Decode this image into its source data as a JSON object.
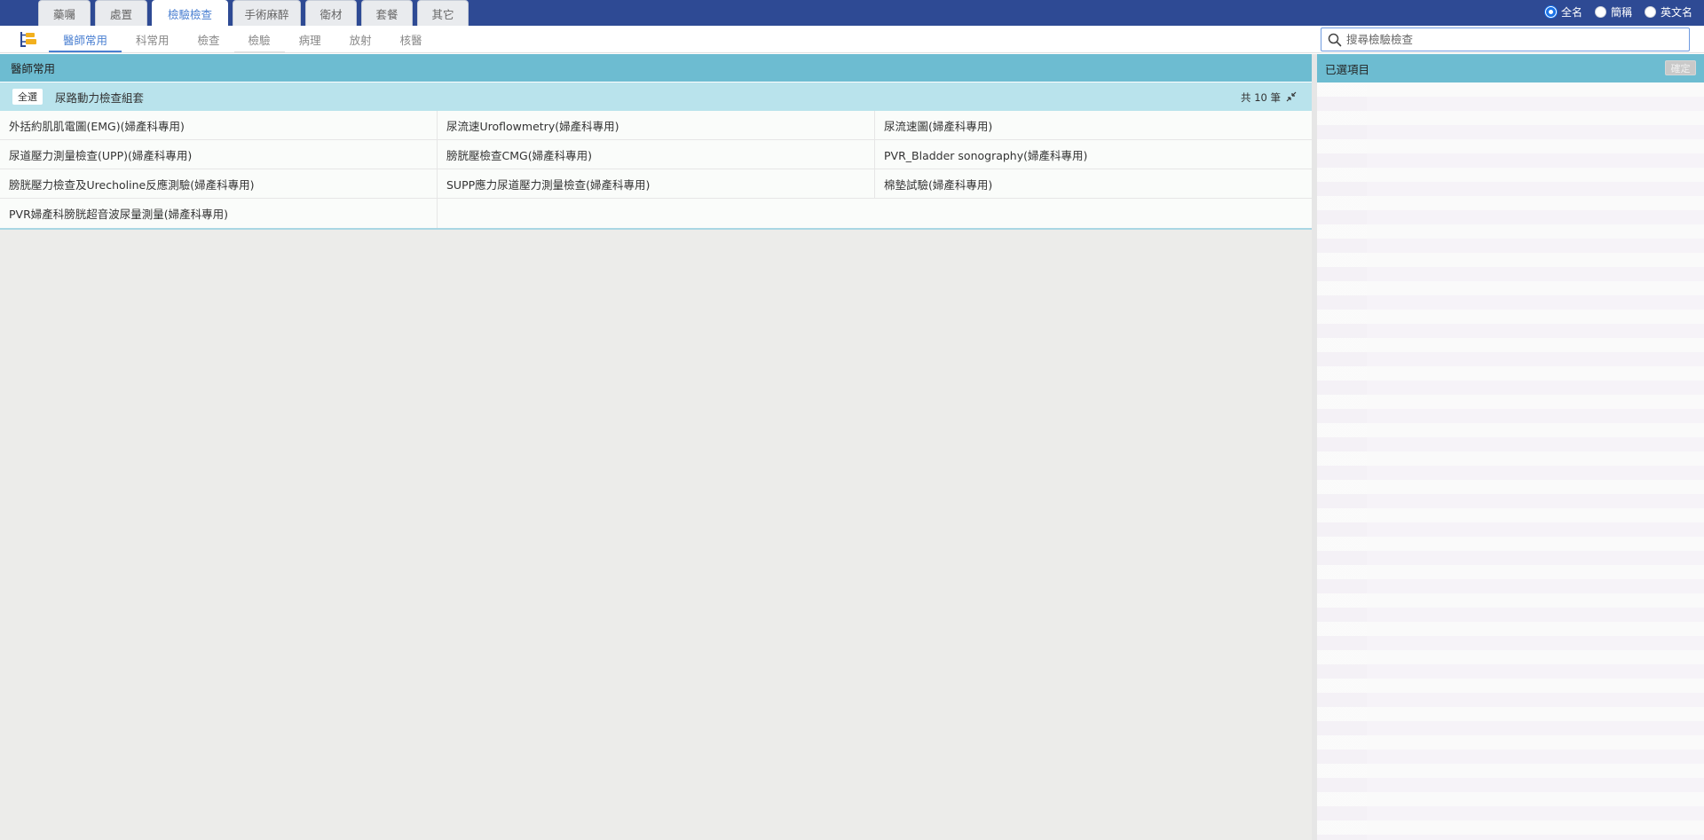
{
  "main_tabs": [
    {
      "label": "藥囑",
      "active": false
    },
    {
      "label": "處置",
      "active": false
    },
    {
      "label": "檢驗檢查",
      "active": true
    },
    {
      "label": "手術麻醉",
      "active": false
    },
    {
      "label": "衛材",
      "active": false
    },
    {
      "label": "套餐",
      "active": false
    },
    {
      "label": "其它",
      "active": false
    }
  ],
  "name_mode": {
    "options": [
      "全名",
      "簡稱",
      "英文名"
    ],
    "selected": "全名"
  },
  "sub_tabs": [
    {
      "label": "醫師常用",
      "active": true
    },
    {
      "label": "科常用",
      "active": false
    },
    {
      "label": "檢查",
      "active": false
    },
    {
      "label": "檢驗",
      "active": false
    },
    {
      "label": "病理",
      "active": false
    },
    {
      "label": "放射",
      "active": false
    },
    {
      "label": "核醫",
      "active": false
    }
  ],
  "search": {
    "placeholder": "搜尋檢驗檢查",
    "value": ""
  },
  "left": {
    "section_title": "醫師常用",
    "group": {
      "select_all_label": "全選",
      "title": "尿路動力檢查組套",
      "count_label": "共 10 筆"
    },
    "items": [
      [
        "外括約肌肌電圖(EMG)(婦產科專用)",
        "尿流速Uroflowmetry(婦產科專用)",
        "尿流速圖(婦產科專用)"
      ],
      [
        "尿道壓力測量檢查(UPP)(婦產科專用)",
        "膀胱壓檢查CMG(婦產科專用)",
        "PVR_Bladder sonography(婦產科專用)"
      ],
      [
        "膀胱壓力檢查及Urecholine反應測驗(婦產科專用)",
        "SUPP應力尿道壓力測量檢查(婦產科專用)",
        "棉墊試驗(婦產科專用)"
      ],
      [
        "PVR婦產科膀胱超音波尿量測量(婦產科專用)",
        "",
        ""
      ]
    ]
  },
  "right": {
    "title": "已選項目",
    "confirm_label": "確定"
  },
  "colors": {
    "topbar": "#2e4a94",
    "header_teal": "#6dbcd1",
    "group_bar": "#b9e3ec",
    "accent_blue": "#4a7fd1"
  }
}
